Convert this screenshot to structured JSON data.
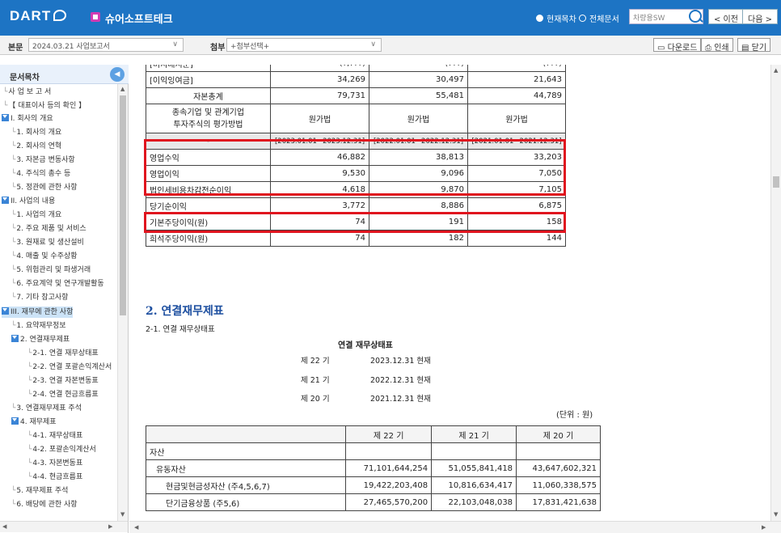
{
  "app": {
    "logo": "DART",
    "company": "슈어소프트테크"
  },
  "header": {
    "radio_current": "현재목차",
    "radio_all": "전체문서",
    "search_placeholder": "차량용SW",
    "prev_label": "< 이전",
    "next_label": "다음 >"
  },
  "toolbar": {
    "doc_label": "본문",
    "doc_value": "2024.03.21  사업보고서",
    "attach_label": "첨부",
    "attach_value": "+첨부선택+",
    "download_label": "다운로드",
    "print_label": "인쇄",
    "close_label": "닫기"
  },
  "sidebar": {
    "title": "문서목차",
    "items": [
      {
        "label": "사 업 보 고 서"
      },
      {
        "label": "【 대표이사 등의 확인 】"
      },
      {
        "label": "I. 회사의 개요"
      },
      {
        "label": "1. 회사의 개요"
      },
      {
        "label": "2. 회사의 연혁"
      },
      {
        "label": "3. 자본금 변동사항"
      },
      {
        "label": "4. 주식의 총수 등"
      },
      {
        "label": "5. 정관에 관한 사항"
      },
      {
        "label": "II. 사업의 내용"
      },
      {
        "label": "1. 사업의 개요"
      },
      {
        "label": "2. 주요 제품 및 서비스"
      },
      {
        "label": "3. 원재료 및 생산설비"
      },
      {
        "label": "4. 매출 및 수주상황"
      },
      {
        "label": "5. 위험관리 및 파생거래"
      },
      {
        "label": "6. 주요계약 및 연구개발활동"
      },
      {
        "label": "7. 기타 참고사항"
      },
      {
        "label": "III. 재무에 관한 사항"
      },
      {
        "label": "1. 요약재무정보"
      },
      {
        "label": "2. 연결재무제표"
      },
      {
        "label": "2-1. 연결 재무상태표"
      },
      {
        "label": "2-2. 연결 포괄손익계산서"
      },
      {
        "label": "2-3. 연결 자본변동표"
      },
      {
        "label": "2-4. 연결 현금흐름표"
      },
      {
        "label": "3. 연결재무제표 주석"
      },
      {
        "label": "4. 재무제표"
      },
      {
        "label": "4-1. 재무상태표"
      },
      {
        "label": "4-2. 포괄손익계산서"
      },
      {
        "label": "4-3. 자본변동표"
      },
      {
        "label": "4-4. 현금흐름표"
      },
      {
        "label": "5. 재무제표 주석"
      },
      {
        "label": "6. 배당에 관한 사항"
      }
    ]
  },
  "summary_table": {
    "top_partial": [
      "[비지배지분]",
      "(?,???)",
      "(???)",
      "(???)"
    ],
    "rows_before": [
      {
        "label": "[이익잉여금]",
        "v": [
          "34,269",
          "30,497",
          "21,643"
        ]
      },
      {
        "label": "자본총계",
        "v": [
          "79,731",
          "55,481",
          "44,789"
        ]
      }
    ],
    "method_label_1": "종속기업 및 관계기업",
    "method_label_2": "투자주식의 평가방법",
    "method_values": [
      "원가법",
      "원가법",
      "원가법"
    ],
    "period_label": "-",
    "periods": [
      "[2023.01.01~2023.12.31]",
      "[2022.01.01~2022.12.31]",
      "[2021.01.01~2021.12.31]"
    ],
    "rows_after": [
      {
        "label": "영업수익",
        "v": [
          "46,882",
          "38,813",
          "33,203"
        ]
      },
      {
        "label": "영업이익",
        "v": [
          "9,530",
          "9,096",
          "7,050"
        ]
      },
      {
        "label": "법인세비용차감전순이익",
        "v": [
          "4,618",
          "9,870",
          "7,105"
        ]
      },
      {
        "label": "당기순이익",
        "v": [
          "3,772",
          "8,886",
          "6,875"
        ]
      },
      {
        "label": "기본주당이익(원)",
        "v": [
          "74",
          "191",
          "158"
        ]
      },
      {
        "label": "희석주당이익(원)",
        "v": [
          "74",
          "182",
          "144"
        ]
      }
    ]
  },
  "section": {
    "title": "2. 연결재무제표",
    "subtitle": "2-1. 연결 재무상태표",
    "statement_title": "연결 재무상태표",
    "periods": [
      {
        "term": "제 22 기",
        "date": "2023.12.31 현재"
      },
      {
        "term": "제 21 기",
        "date": "2022.12.31 현재"
      },
      {
        "term": "제 20 기",
        "date": "2021.12.31 현재"
      }
    ],
    "unit": "(단위 : 원)"
  },
  "balance_table": {
    "headers": [
      "제 22 기",
      "제 21 기",
      "제 20 기"
    ],
    "rows": [
      {
        "label": "자산",
        "v": [
          "",
          "",
          ""
        ]
      },
      {
        "label": "유동자산",
        "v": [
          "71,101,644,254",
          "51,055,841,418",
          "43,647,602,321"
        ]
      },
      {
        "label": "현금및현금성자산 (주4,5,6,7)",
        "v": [
          "19,422,203,408",
          "10,816,634,417",
          "11,060,338,575"
        ]
      },
      {
        "label": "단기금융상품 (주5,6)",
        "v": [
          "27,465,570,200",
          "22,103,048,038",
          "17,831,421,638"
        ]
      }
    ]
  },
  "colors": {
    "brand": "#1d74c4",
    "highlight": "#e0141e",
    "section_title": "#1d4fa0"
  }
}
